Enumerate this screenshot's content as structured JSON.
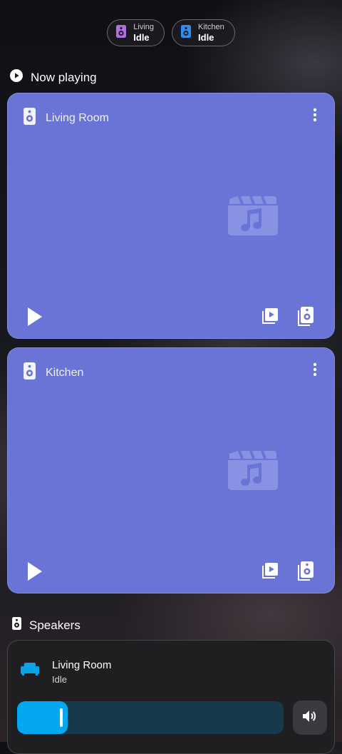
{
  "chips": [
    {
      "name": "Living",
      "state": "Idle",
      "icon": "speaker-icon",
      "color": "#b06ee0"
    },
    {
      "name": "Kitchen",
      "state": "Idle",
      "icon": "speaker-icon",
      "color": "#2e8ef0"
    }
  ],
  "now_playing": {
    "title": "Now playing",
    "icon": "play-circle-icon",
    "cards": [
      {
        "room": "Living Room",
        "icon": "speaker-icon",
        "placeholder_icon": "music-video-icon"
      },
      {
        "room": "Kitchen",
        "icon": "speaker-icon",
        "placeholder_icon": "music-video-icon"
      }
    ],
    "card_color": "#6a74d6"
  },
  "speakers": {
    "title": "Speakers",
    "icon": "speaker-icon",
    "items": [
      {
        "name": "Living Room",
        "state": "Idle",
        "icon": "sofa-icon",
        "volume": 0.19,
        "accent": "#04a8f0"
      }
    ]
  }
}
